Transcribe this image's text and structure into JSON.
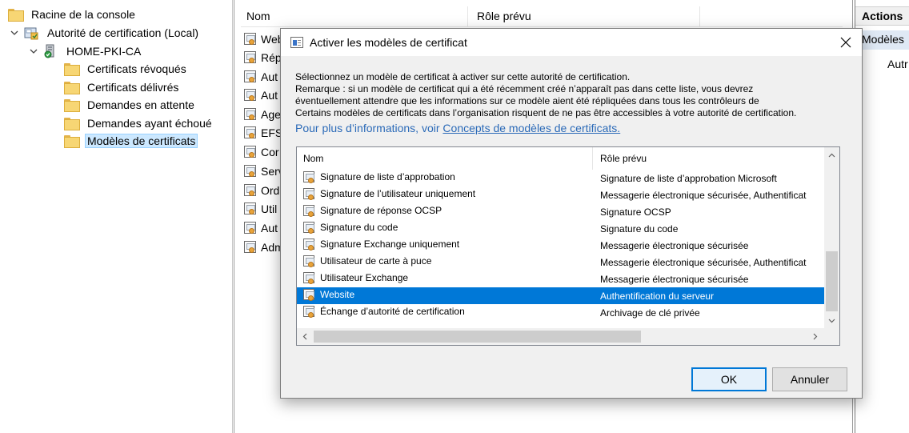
{
  "tree": {
    "root": "Racine de la console",
    "authority": "Autorité de certification (Local)",
    "ca": "HOME-PKI-CA",
    "folders": [
      "Certificats révoqués",
      "Certificats délivrés",
      "Demandes en attente",
      "Demandes ayant échoué",
      "Modèles de certificats"
    ]
  },
  "middle": {
    "columns": [
      "Nom",
      "Rôle prévu"
    ],
    "rows": [
      "Web",
      "Rép",
      "Aut",
      "Aut",
      "Age",
      "EFS",
      "Cor",
      "Serv",
      "Ord",
      "Util",
      "Aut",
      "Adm"
    ]
  },
  "actions": {
    "title": "Actions",
    "section": "Modèles",
    "item": "Autr"
  },
  "dialog": {
    "title": "Activer les modèles de certificat",
    "info_lines": [
      "Sélectionnez un modèle de certificat à activer sur cette autorité de certification.",
      "Remarque : si un modèle de certificat qui a été récemment créé n’apparaît pas dans cette liste, vous devrez",
      "éventuellement attendre que les informations sur ce modèle aient été répliquées dans tous les contrôleurs de",
      "Certains modèles de certificats dans l’organisation risquent de ne pas être accessibles à votre autorité de certification."
    ],
    "more_prefix": "Pour plus d’informations, voir ",
    "more_link": "Concepts de modèles de certificats.",
    "list_columns": [
      "Nom",
      "Rôle prévu"
    ],
    "list_rows": [
      {
        "name": "Signature de liste d’approbation",
        "role": "Signature de liste d’approbation Microsoft"
      },
      {
        "name": "Signature de l’utilisateur uniquement",
        "role": "Messagerie électronique sécurisée, Authentificat"
      },
      {
        "name": "Signature de réponse OCSP",
        "role": "Signature OCSP"
      },
      {
        "name": "Signature du code",
        "role": "Signature du code"
      },
      {
        "name": "Signature Exchange uniquement",
        "role": "Messagerie électronique sécurisée"
      },
      {
        "name": "Utilisateur de carte à puce",
        "role": "Messagerie électronique sécurisée, Authentificat"
      },
      {
        "name": "Utilisateur Exchange",
        "role": "Messagerie électronique sécurisée"
      },
      {
        "name": "Website",
        "role": "Authentification du serveur"
      },
      {
        "name": "Échange d’autorité de certification",
        "role": "Archivage de clé privée"
      }
    ],
    "selected_row": "Website",
    "ok_label": "OK",
    "cancel_label": "Annuler"
  },
  "colors": {
    "selection": "#0078d7",
    "link": "#2b6ab8",
    "tree_selection": "#cce8ff"
  }
}
